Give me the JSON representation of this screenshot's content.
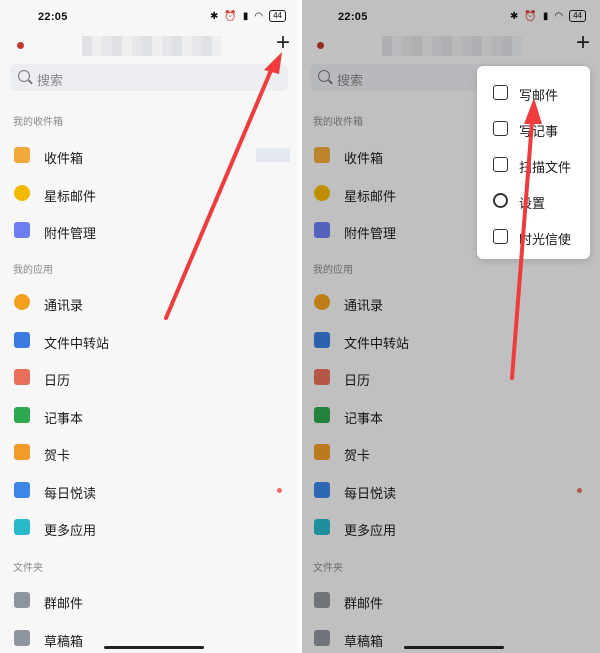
{
  "status": {
    "time": "22:05",
    "battery": "44"
  },
  "search": {
    "placeholder": "搜索"
  },
  "sections": {
    "mailbox": "我的收件箱",
    "apps": "我的应用",
    "folders": "文件夹"
  },
  "mailbox_items": [
    {
      "label": "收件箱",
      "icon": "inbox-icon",
      "color": "#f2a93b"
    },
    {
      "label": "星标邮件",
      "icon": "star-icon",
      "color": "#f5b800"
    },
    {
      "label": "附件管理",
      "icon": "attachment-icon",
      "color": "#6c7ef0"
    }
  ],
  "app_items": [
    {
      "label": "通讯录",
      "icon": "contacts-icon",
      "color": "#f2a01e"
    },
    {
      "label": "文件中转站",
      "icon": "file-transfer-icon",
      "color": "#3a7be0"
    },
    {
      "label": "日历",
      "icon": "calendar-icon",
      "color": "#ea6f5a"
    },
    {
      "label": "记事本",
      "icon": "notepad-icon",
      "color": "#2ea84e"
    },
    {
      "label": "贺卡",
      "icon": "greeting-card-icon",
      "color": "#f09b2a"
    },
    {
      "label": "每日悦读",
      "icon": "daily-reading-icon",
      "color": "#3c86e8"
    },
    {
      "label": "更多应用",
      "icon": "more-apps-icon",
      "color": "#29b8c9"
    }
  ],
  "folder_items": [
    {
      "label": "群邮件",
      "icon": "group-mail-icon",
      "color": "#8f959d"
    },
    {
      "label": "草稿箱",
      "icon": "drafts-icon",
      "color": "#8f959d"
    }
  ],
  "menu_items": [
    {
      "label": "写邮件",
      "icon": "compose-icon"
    },
    {
      "label": "写记事",
      "icon": "write-note-icon"
    },
    {
      "label": "扫描文件",
      "icon": "scan-file-icon"
    },
    {
      "label": "设置",
      "icon": "settings-icon"
    },
    {
      "label": "时光信使",
      "icon": "time-messenger-icon"
    }
  ],
  "colors": {
    "arrow": "#ef3b3b",
    "accent_dot": "#c0392b"
  }
}
